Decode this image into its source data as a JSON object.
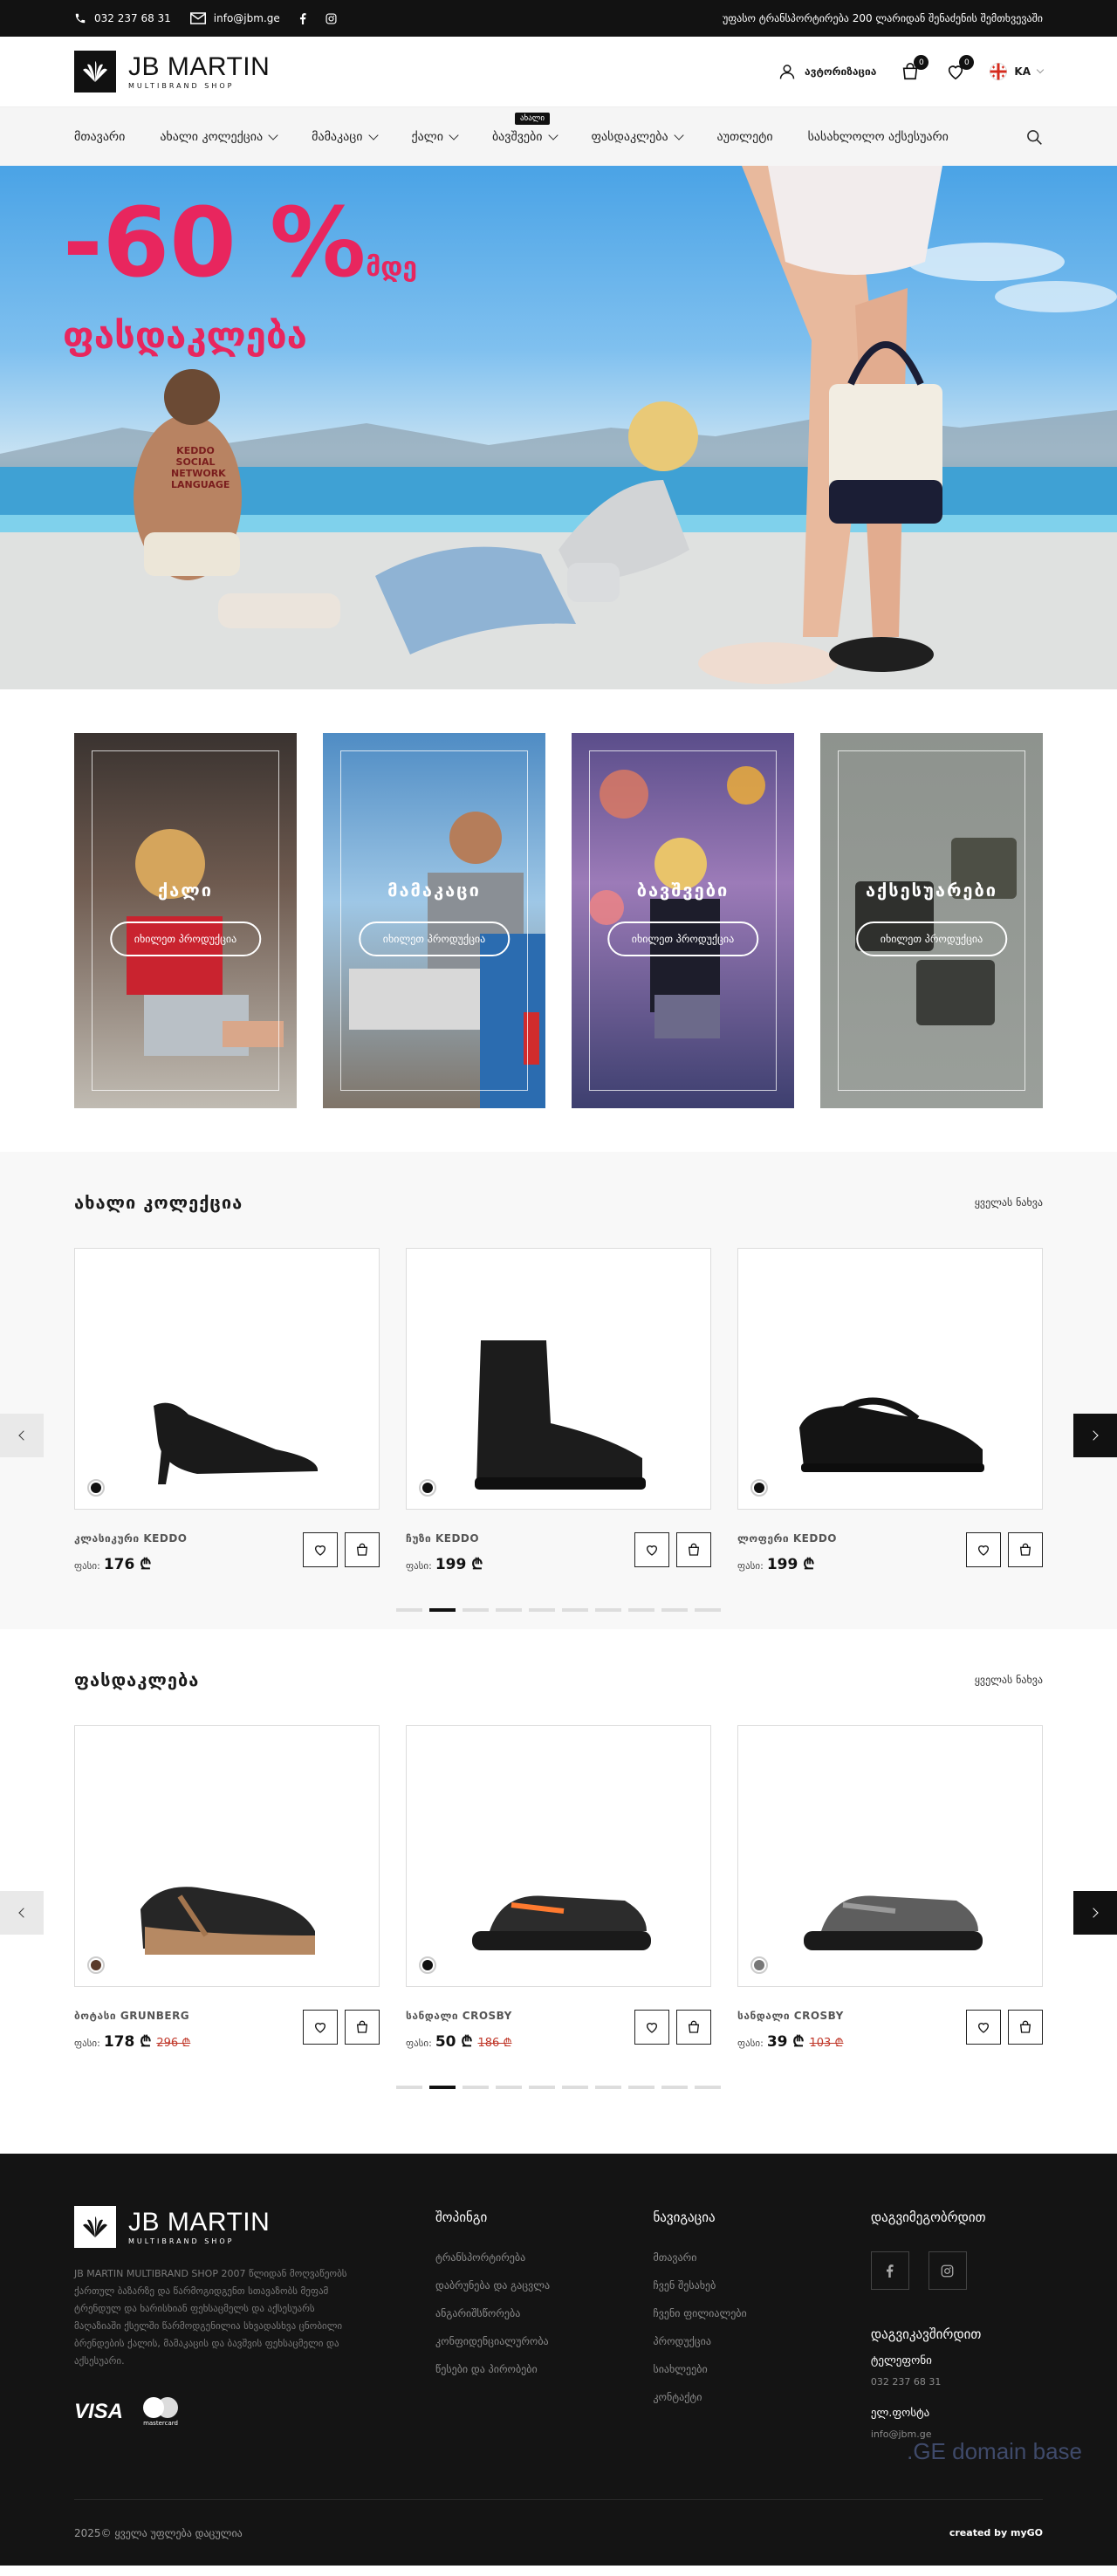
{
  "topbar": {
    "phone": "032 237 68 31",
    "email": "info@jbm.ge",
    "promo": "უფასო ტრანსპორტირება 200 ლარიდან შენაძენის შემთხვევაში"
  },
  "header": {
    "brand": "JB MARTIN",
    "brand_sub": "MULTIBRAND SHOP",
    "auth_label": "ავტორიზაცია",
    "cart_count": "0",
    "wishlist_count": "0",
    "lang": "KA"
  },
  "nav": {
    "items": [
      {
        "label": "მთავარი"
      },
      {
        "label": "ახალი კოლექცია"
      },
      {
        "label": "მამაკაცი"
      },
      {
        "label": "ქალი"
      },
      {
        "label": "ბავშვები"
      },
      {
        "label": "ფასდაკლება"
      },
      {
        "label": "აუთლეტი"
      },
      {
        "label": "სასახლოლო აქსესუარი"
      }
    ],
    "new_tag": "ახალი"
  },
  "hero": {
    "sale_line1": "-60 %",
    "sale_upto": "მდე",
    "sale_line2": "ფასდაკლება",
    "tattoo": "KEDDO SOCIAL NETWORK LANGUAGE"
  },
  "categories": [
    {
      "title": "ქალი",
      "button": "იხილეთ პროდუქცია"
    },
    {
      "title": "მამაკაცი",
      "button": "იხილეთ პროდუქცია"
    },
    {
      "title": "ბავშვები",
      "button": "იხილეთ პროდუქცია"
    },
    {
      "title": "აქსესუარები",
      "button": "იხილეთ პროდუქცია"
    }
  ],
  "new_collection": {
    "title": "ახალი კოლექცია",
    "see_all": "ყველას ნახვა",
    "products": [
      {
        "name": "კლასიკური KEDDO",
        "price_label": "ფასი:",
        "price": "176 ₾",
        "old_price": ""
      },
      {
        "name": "ჩუზი KEDDO",
        "price_label": "ფასი:",
        "price": "199 ₾",
        "old_price": ""
      },
      {
        "name": "ლოფერი KEDDO",
        "price_label": "ფასი:",
        "price": "199 ₾",
        "old_price": ""
      }
    ]
  },
  "sale": {
    "title": "ფასდაკლება",
    "see_all": "ყველას ნახვა",
    "products": [
      {
        "name": "ბოტასი GRUNBERG",
        "price_label": "ფასი:",
        "price": "178 ₾",
        "old_price": "296 ₾"
      },
      {
        "name": "სანდალი CROSBY",
        "price_label": "ფასი:",
        "price": "50 ₾",
        "old_price": "186 ₾"
      },
      {
        "name": "სანდალი CROSBY",
        "price_label": "ფასი:",
        "price": "39 ₾",
        "old_price": "103 ₾"
      }
    ]
  },
  "footer": {
    "brand": "JB MARTIN",
    "brand_sub": "MULTIBRAND SHOP",
    "description": "JB MARTIN MULTIBRAND SHOP 2007 წლიდან მოღვაწეობს ქართულ ბაზარზე და წარმოგიდგენთ სთავაზობს მეფამ ტრენდულ და ხარისხიან ფეხსაცმელს და აქსესუარს მაღაზიაში ქსელში წარმოდგენილია სხვადასხვა ცნობილი ბრენდების ქალის, მამაკაცის და ბავშვის ფეხსაცმელი და აქსესუარი.",
    "visa": "VISA",
    "mastercard": "mastercard",
    "shopping_title": "შოპინგი",
    "shopping_links": [
      "ტრანსპორტირება",
      "დაბრუნება და გაცვლა",
      "ანგარიშსწორება",
      "კონფიდენციალურობა",
      "წესები და პირობები"
    ],
    "nav_title": "ნავიგაცია",
    "nav_links": [
      "მთავარი",
      "ჩვენ შესახებ",
      "ჩვენი ფილიალები",
      "პროდუქცია",
      "სიახლეები",
      "კონტაქტი"
    ],
    "follow_title": "დაგვიმეგობრდით",
    "contact_title": "დაგვიკავშირდით",
    "phone_label": "ტელეფონი",
    "phone": "032 237 68 31",
    "email_label": "ელ.ფოსტა",
    "email": "info@jbm.ge",
    "copyright": "2025© ყველა უფლება დაცულია",
    "created_by": "created by myGO",
    "watermark": ".GE domain base"
  },
  "colors": {
    "accent_sale": "#e8265e",
    "dark": "#111111"
  }
}
